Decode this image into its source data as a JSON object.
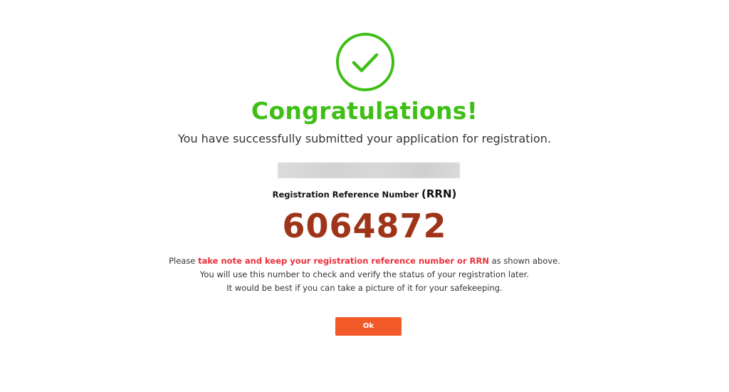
{
  "success": {
    "icon": "check-circle-icon",
    "icon_color": "#3fbf16",
    "title": "Congratulations!",
    "subtitle": "You have successfully submitted your application for registration."
  },
  "registration": {
    "label_main": "Registration Reference Number ",
    "label_abbr": "(RRN)",
    "number": "6064872",
    "number_color": "#9e3418"
  },
  "note": {
    "line1_prefix": "Please ",
    "line1_emphasis": "take note and keep your registration reference number or RRN",
    "line1_suffix": " as shown above.",
    "line2": "You will use this number to check and verify the status of your registration later.",
    "line3": "It would be best if you can take a picture of it for your safekeeping.",
    "emphasis_color": "#e8313a"
  },
  "actions": {
    "ok_label": "Ok",
    "ok_color": "#f35a2a"
  }
}
